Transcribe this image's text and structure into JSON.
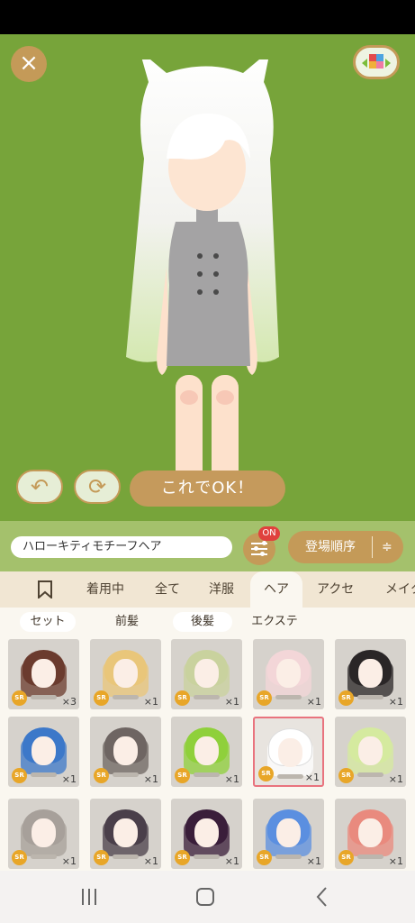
{
  "top_controls": {
    "close_icon": "×",
    "ok_label": "これでOK！",
    "undo_icon": "undo-icon",
    "shuffle_icon": "refresh-icon"
  },
  "item_bar": {
    "name": "ハローキティモチーフヘア",
    "filter_badge": "ON",
    "sort_label": "登場順序"
  },
  "category_tabs": [
    {
      "label": "着用中"
    },
    {
      "label": "全て"
    },
    {
      "label": "洋服"
    },
    {
      "label": "ヘア",
      "active": true
    },
    {
      "label": "アクセ"
    },
    {
      "label": "メイク"
    }
  ],
  "sub_tabs": [
    {
      "label": "セット"
    },
    {
      "label": "前髪"
    },
    {
      "label": "後髪"
    },
    {
      "label": "エクステ"
    }
  ],
  "items": [
    {
      "rarity": "SR",
      "count": "×3",
      "hair_color": "#6b3b2e"
    },
    {
      "rarity": "SR",
      "count": "×1",
      "hair_color": "#e9c67a"
    },
    {
      "rarity": "SR",
      "count": "×1",
      "hair_color": "#c9d29e"
    },
    {
      "rarity": "SR",
      "count": "×1",
      "hair_color": "#f3d6d8"
    },
    {
      "rarity": "SR",
      "count": "×1",
      "hair_color": "#2a2627"
    },
    {
      "rarity": "SR",
      "count": "×1",
      "hair_color": "#3c78c9"
    },
    {
      "rarity": "SR",
      "count": "×1",
      "hair_color": "#6e6562"
    },
    {
      "rarity": "SR",
      "count": "×1",
      "hair_color": "#8fd03b"
    },
    {
      "rarity": "SR",
      "count": "×1",
      "hair_color": "#ffffff",
      "selected": true
    },
    {
      "rarity": "SR",
      "count": "×1",
      "hair_color": "#d5ea9f"
    },
    {
      "rarity": "SR",
      "count": "×1",
      "hair_color": "#a7a09a"
    },
    {
      "rarity": "SR",
      "count": "×1",
      "hair_color": "#4a3f4a"
    },
    {
      "rarity": "SR",
      "count": "×1",
      "hair_color": "#3a1e3a"
    },
    {
      "rarity": "SR",
      "count": "×1",
      "hair_color": "#5b8fe0"
    },
    {
      "rarity": "SR",
      "count": "×1",
      "hair_color": "#e98a7e"
    }
  ],
  "colors": {
    "stage_bg": "#77a43a",
    "accent": "#c49a58",
    "badge": "#e0413d",
    "selected_border": "#e9737e"
  }
}
